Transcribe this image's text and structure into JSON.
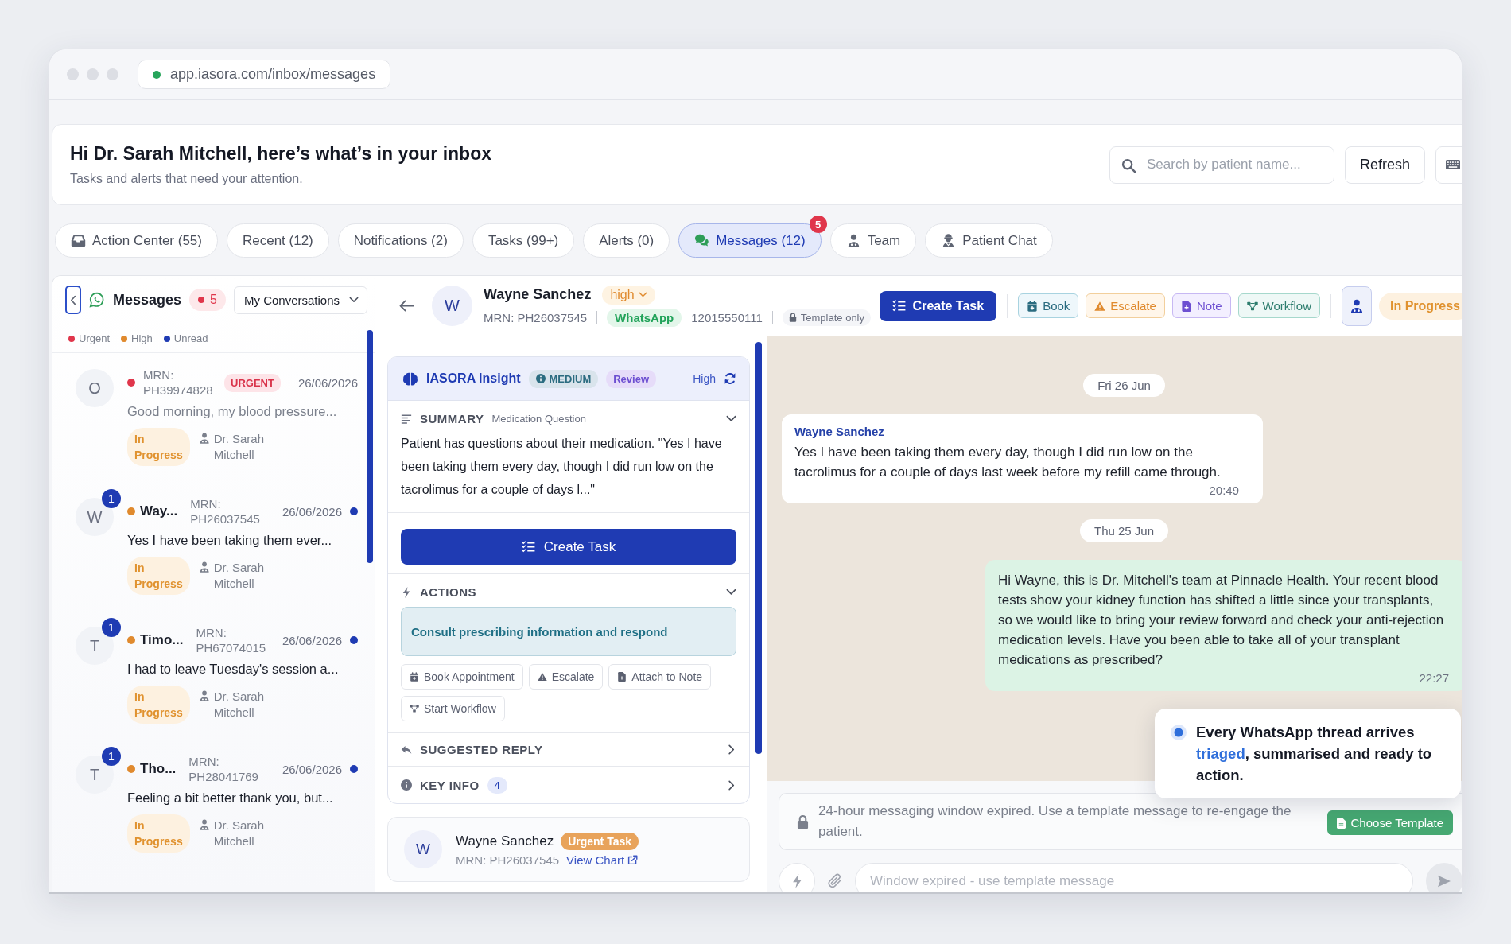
{
  "browser": {
    "url": "app.iasora.com/inbox/messages"
  },
  "header": {
    "title": "Hi Dr. Sarah Mitchell, here’s what’s in your inbox",
    "subtitle": "Tasks and alerts that need your attention.",
    "search": {
      "placeholder": "Search by patient name..."
    },
    "buttons": [
      {
        "kind": "text",
        "label": "Refresh"
      },
      {
        "kind": "keyboard"
      }
    ]
  },
  "tabs": [
    {
      "label": "Action Center (55)",
      "kind": "inbox",
      "selected": false
    },
    {
      "label": "Recent (12)",
      "kind": "plain",
      "selected": false
    },
    {
      "label": "Notifications (2)",
      "kind": "plain",
      "selected": false
    },
    {
      "label": "Tasks (99+)",
      "kind": "plain",
      "selected": false
    },
    {
      "label": "Alerts (0)",
      "kind": "plain",
      "selected": false
    },
    {
      "label": "Messages (12)",
      "kind": "chat",
      "selected": true,
      "badge": "5"
    },
    {
      "label": "Team",
      "kind": "staff",
      "selected": false
    },
    {
      "label": "Patient Chat",
      "kind": "patient",
      "selected": false
    }
  ],
  "conversations": {
    "title": "Messages",
    "count": "5",
    "filter": "My Conversations",
    "legend": [
      {
        "label": "Urgent",
        "color": "#e0364b"
      },
      {
        "label": "High",
        "color": "#e08a2e"
      },
      {
        "label": "Unread",
        "color": "#1f3bb3"
      }
    ],
    "items": [
      {
        "avatar": "O",
        "color": "#e0364b",
        "mrn": "MRN: PH39974828",
        "tag": "URGENT",
        "date": "26/06/2026",
        "unread": false,
        "preview": "Good morning, my blood pressure...",
        "status": "In Progress",
        "assignee": "Dr. Sarah Mitchell"
      },
      {
        "avatar": "W",
        "unread_count": "1",
        "color": "#e08a2e",
        "name": "Way...",
        "mrn": "MRN: PH26037545",
        "date": "26/06/2026",
        "unread": true,
        "preview": "Yes I have been taking them ever...",
        "status": "In Progress",
        "assignee": "Dr. Sarah Mitchell"
      },
      {
        "avatar": "T",
        "unread_count": "1",
        "color": "#e08a2e",
        "name": "Timo...",
        "mrn": "MRN: PH67074015",
        "date": "26/06/2026",
        "unread": true,
        "preview": "I had to leave Tuesday's session a...",
        "status": "In Progress",
        "assignee": "Dr. Sarah Mitchell"
      },
      {
        "avatar": "T",
        "unread_count": "1",
        "color": "#e08a2e",
        "name": "Tho...",
        "mrn": "MRN: PH28041769",
        "date": "26/06/2026",
        "unread": true,
        "preview": "Feeling a bit better thank you, but...",
        "status": "In Progress",
        "assignee": "Dr. Sarah Mitchell"
      }
    ]
  },
  "conversation": {
    "patient": {
      "avatar": "W",
      "name": "Wayne Sanchez",
      "priority": "high",
      "mrn": "MRN: PH26037545",
      "channel": "WhatsApp",
      "phone": "12015550111",
      "template_note": "Template only"
    },
    "actions": [
      {
        "kind": "primary",
        "label": "Create Task"
      },
      {
        "kind": "book",
        "label": "Book"
      },
      {
        "kind": "escalate",
        "label": "Escalate"
      },
      {
        "kind": "note",
        "label": "Note"
      },
      {
        "kind": "workflow",
        "label": "Workflow"
      },
      {
        "kind": "staff"
      }
    ],
    "status": "In Progress"
  },
  "insight": {
    "title": "IASORA Insight",
    "confidence": "MEDIUM",
    "review": "Review",
    "urgency": "High",
    "summary": {
      "title": "SUMMARY",
      "category": "Medication Question",
      "expanded": true,
      "text": "Patient has questions about their medication. \"Yes I have been taking them every day, though I did run low on the tacrolimus for a couple of days l...\""
    },
    "create_task": "Create Task",
    "actions": {
      "title": "ACTIONS",
      "expanded": true,
      "suggestion": "Consult prescribing information and respond",
      "buttons": [
        {
          "kind": "book",
          "label": "Book Appointment"
        },
        {
          "kind": "escalate",
          "label": "Escalate"
        },
        {
          "kind": "note",
          "label": "Attach to Note"
        },
        {
          "kind": "workflow",
          "label": "Start Workflow"
        }
      ]
    },
    "suggested_reply": {
      "title": "SUGGESTED REPLY",
      "expanded": false
    },
    "key_info": {
      "title": "KEY INFO",
      "count": "4",
      "expanded": false
    }
  },
  "patient_card": {
    "avatar": "W",
    "name": "Wayne Sanchez",
    "tag": "Urgent Task",
    "mrn": "MRN: PH26037545",
    "link": "View Chart"
  },
  "chat": {
    "messages": [
      {
        "kind": "date",
        "label": "Fri 26 Jun"
      },
      {
        "kind": "incoming",
        "sender": "Wayne Sanchez",
        "text": "Yes I have been taking them every day, though I did run low on the tacrolimus for a couple of days last week before my refill came through.",
        "time": "20:49"
      },
      {
        "kind": "date",
        "label": "Thu 25 Jun"
      },
      {
        "kind": "outgoing",
        "text": "Hi Wayne, this is Dr. Mitchell's team at Pinnacle Health. Your recent blood tests show your kidney function has shifted a little since your transplants, so we would like to bring your review forward and check your anti-rejection medication levels. Have you been able to take all of your transplant medications as prescribed?",
        "time": "22:27"
      }
    ],
    "notice": {
      "text": "24-hour messaging window expired. Use a template message to re-engage the patient.",
      "button": "Choose Template"
    },
    "composer": {
      "placeholder": "Window expired - use template message"
    }
  },
  "callout": {
    "text": "Every WhatsApp thread arrives **triaged**, summarised and ready to action."
  }
}
